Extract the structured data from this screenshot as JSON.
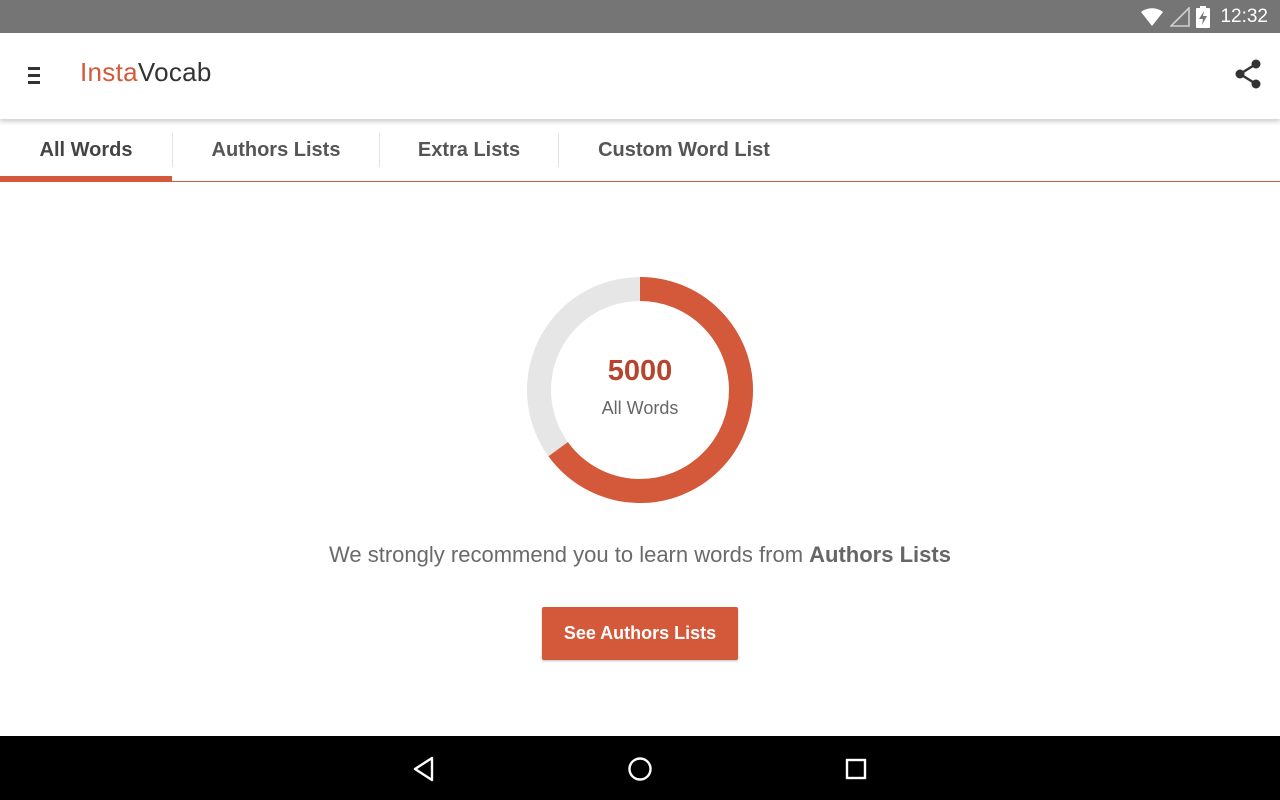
{
  "status_bar": {
    "time": "12:32",
    "icons": [
      "wifi-icon",
      "signal-icon",
      "battery-charging-icon"
    ]
  },
  "app_bar": {
    "title_part1": "Insta",
    "title_part2": "Vocab",
    "icons": [
      "menu-icon",
      "share-icon"
    ]
  },
  "tabs": [
    {
      "label": "All Words",
      "active": true
    },
    {
      "label": "Authors Lists",
      "active": false
    },
    {
      "label": "Extra Lists",
      "active": false
    },
    {
      "label": "Custom Word List",
      "active": false
    }
  ],
  "progress": {
    "count": "5000",
    "label": "All Words",
    "fraction": 0.65
  },
  "recommendation": {
    "text": "We strongly recommend you to learn words from ",
    "emphasis": "Authors Lists"
  },
  "cta": {
    "label": "See Authors Lists"
  },
  "nav_bar": {
    "icons": [
      "back-icon",
      "home-icon",
      "recents-icon"
    ]
  },
  "colors": {
    "accent": "#d4583a",
    "track": "#e6e6e6",
    "count": "#b5452c"
  }
}
